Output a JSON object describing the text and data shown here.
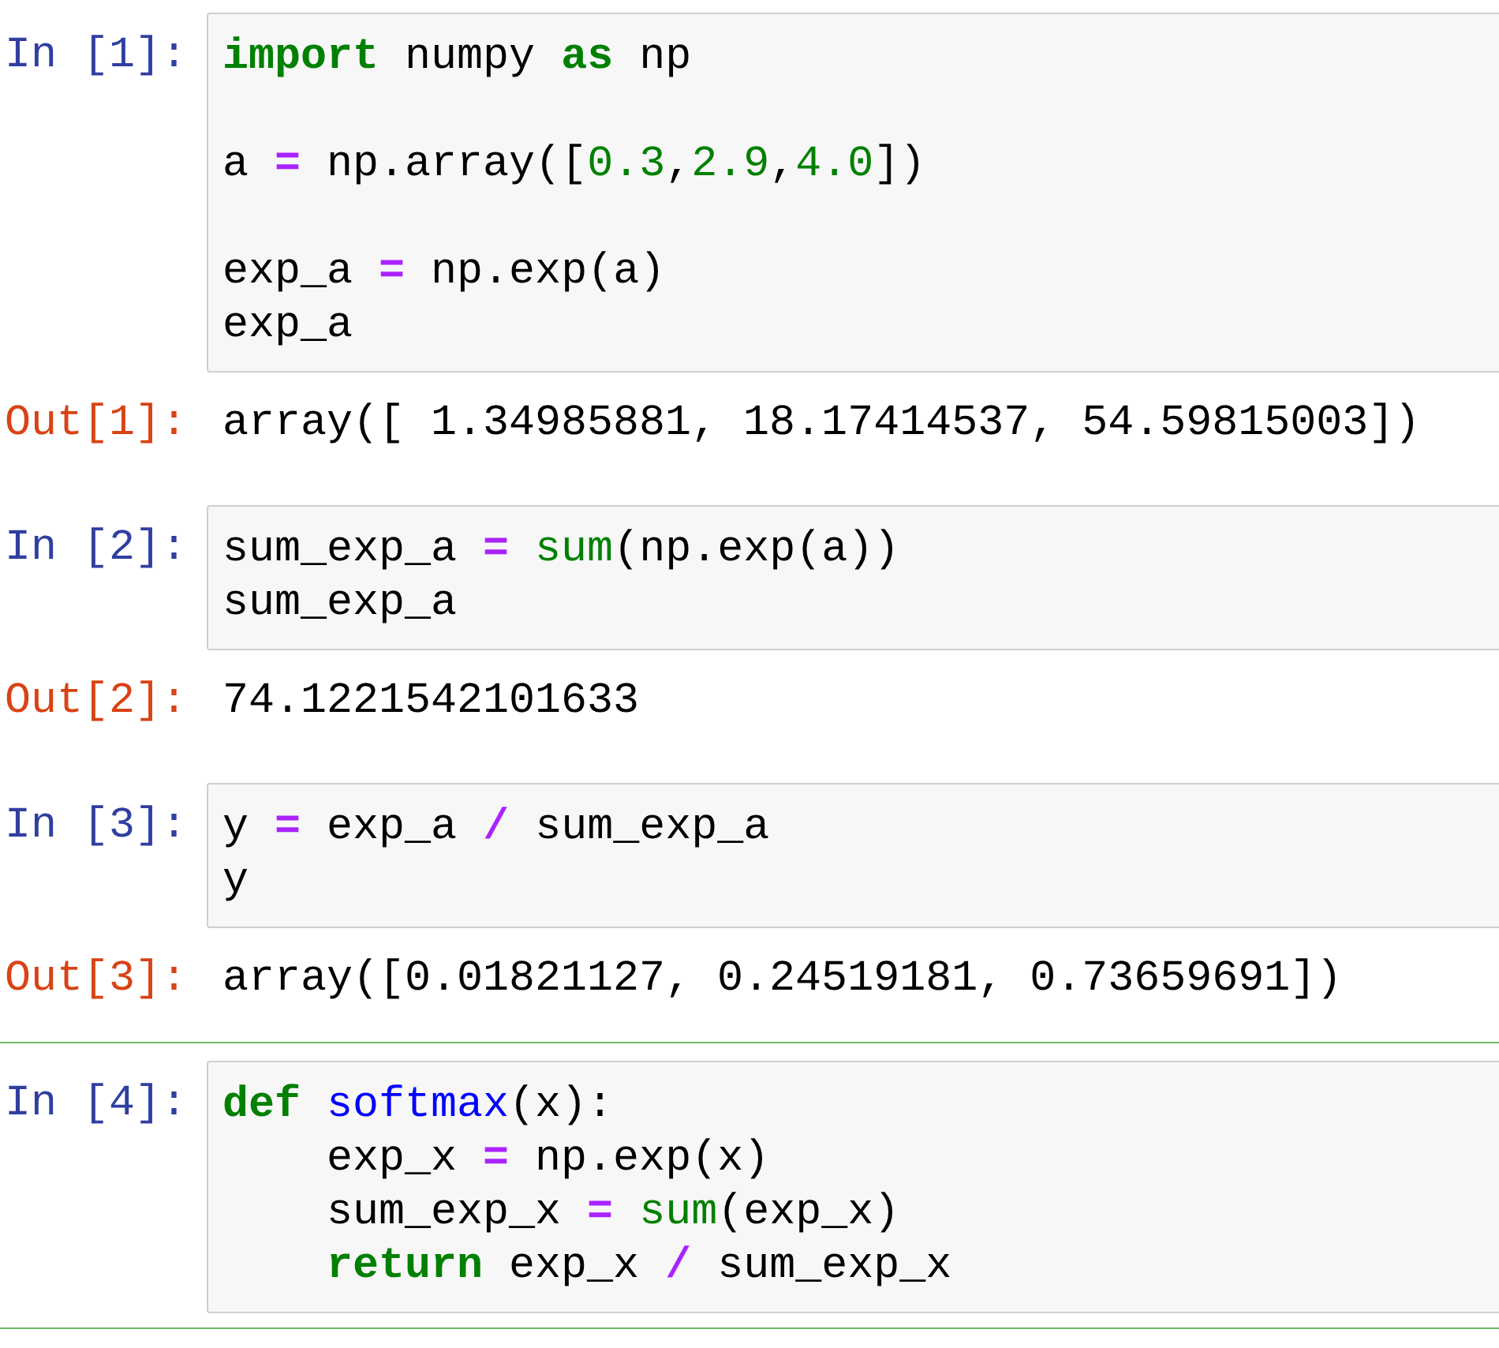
{
  "cells": [
    {
      "prompt": "In [1]:",
      "selected": false,
      "lines": [
        {
          "tokens": [
            {
              "text": "import",
              "kind": "keyword"
            },
            {
              "text": " numpy ",
              "kind": "plain"
            },
            {
              "text": "as",
              "kind": "keyword"
            },
            {
              "text": " np",
              "kind": "plain"
            }
          ]
        },
        {
          "gap_before": true,
          "tokens": [
            {
              "text": "a ",
              "kind": "plain"
            },
            {
              "text": "=",
              "kind": "op"
            },
            {
              "text": " np.array([",
              "kind": "plain"
            },
            {
              "text": "0.3",
              "kind": "number"
            },
            {
              "text": ",",
              "kind": "plain"
            },
            {
              "text": "2.9",
              "kind": "number"
            },
            {
              "text": ",",
              "kind": "plain"
            },
            {
              "text": "4.0",
              "kind": "number"
            },
            {
              "text": "])",
              "kind": "plain"
            }
          ]
        },
        {
          "gap_before": true,
          "tokens": [
            {
              "text": "exp_a ",
              "kind": "plain"
            },
            {
              "text": "=",
              "kind": "op"
            },
            {
              "text": " np.exp(a)",
              "kind": "plain"
            }
          ]
        },
        {
          "tokens": [
            {
              "text": "exp_a",
              "kind": "plain"
            }
          ]
        }
      ],
      "output": {
        "prompt": "Out[1]:",
        "text": "array([ 1.34985881, 18.17414537, 54.59815003])"
      }
    },
    {
      "prompt": "In [2]:",
      "selected": false,
      "lines": [
        {
          "tokens": [
            {
              "text": "sum_exp_a ",
              "kind": "plain"
            },
            {
              "text": "=",
              "kind": "op"
            },
            {
              "text": " sum",
              "kind": "builtin"
            },
            {
              "text": "(np.exp(a))",
              "kind": "plain"
            }
          ]
        },
        {
          "tokens": [
            {
              "text": "sum_exp_a",
              "kind": "plain"
            }
          ]
        }
      ],
      "output": {
        "prompt": "Out[2]:",
        "text": "74.1221542101633"
      }
    },
    {
      "prompt": "In [3]:",
      "selected": false,
      "lines": [
        {
          "tokens": [
            {
              "text": "y ",
              "kind": "plain"
            },
            {
              "text": "=",
              "kind": "op"
            },
            {
              "text": " exp_a ",
              "kind": "plain"
            },
            {
              "text": "/",
              "kind": "op"
            },
            {
              "text": " sum_exp_a",
              "kind": "plain"
            }
          ]
        },
        {
          "tokens": [
            {
              "text": "y",
              "kind": "plain"
            }
          ]
        }
      ],
      "output": {
        "prompt": "Out[3]:",
        "text": "array([0.01821127, 0.24519181, 0.73659691])"
      }
    },
    {
      "prompt": "In [4]:",
      "selected": true,
      "lines": [
        {
          "tokens": [
            {
              "text": "def ",
              "kind": "keyword"
            },
            {
              "text": "softmax",
              "kind": "funcname"
            },
            {
              "text": "(x):",
              "kind": "plain"
            }
          ]
        },
        {
          "tokens": [
            {
              "text": "    exp_x ",
              "kind": "plain"
            },
            {
              "text": "=",
              "kind": "op"
            },
            {
              "text": " np.exp(x)",
              "kind": "plain"
            }
          ]
        },
        {
          "tokens": [
            {
              "text": "    sum_exp_x ",
              "kind": "plain"
            },
            {
              "text": "=",
              "kind": "op"
            },
            {
              "text": " sum",
              "kind": "builtin"
            },
            {
              "text": "(exp_x)",
              "kind": "plain"
            }
          ]
        },
        {
          "tokens": [
            {
              "text": "    return",
              "kind": "keyword"
            },
            {
              "text": " exp_x ",
              "kind": "plain"
            },
            {
              "text": "/",
              "kind": "op"
            },
            {
              "text": " sum_exp_x",
              "kind": "plain"
            }
          ]
        }
      ]
    }
  ]
}
